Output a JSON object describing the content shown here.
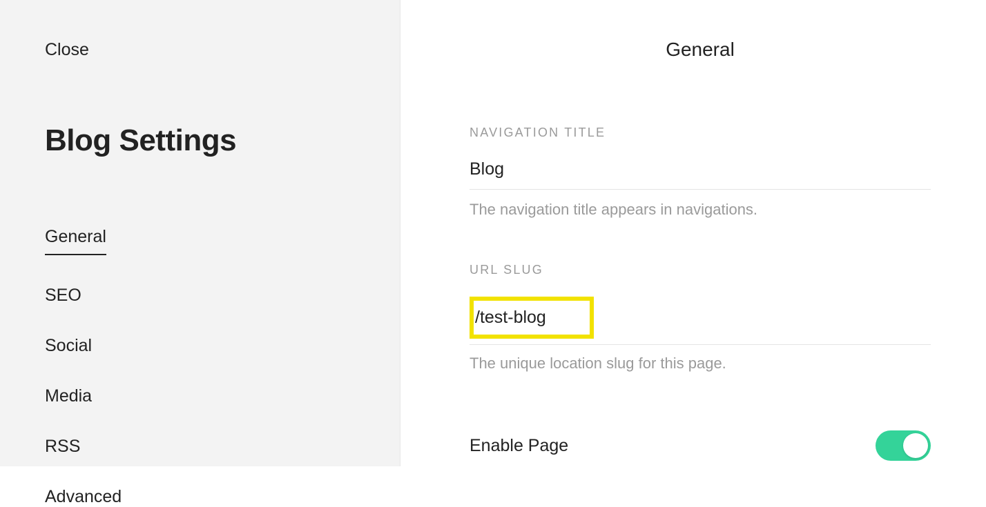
{
  "sidebar": {
    "close_label": "Close",
    "title": "Blog Settings",
    "tabs": [
      {
        "label": "General",
        "active": true
      },
      {
        "label": "SEO",
        "active": false
      },
      {
        "label": "Social",
        "active": false
      },
      {
        "label": "Media",
        "active": false
      },
      {
        "label": "RSS",
        "active": false
      },
      {
        "label": "Advanced",
        "active": false
      }
    ]
  },
  "main": {
    "header": "General",
    "nav_title": {
      "label": "NAVIGATION TITLE",
      "value": "Blog",
      "help": "The navigation title appears in navigations."
    },
    "url_slug": {
      "label": "URL SLUG",
      "value": "/test-blog",
      "help": "The unique location slug for this page."
    },
    "enable_page": {
      "label": "Enable Page",
      "enabled": true
    }
  }
}
